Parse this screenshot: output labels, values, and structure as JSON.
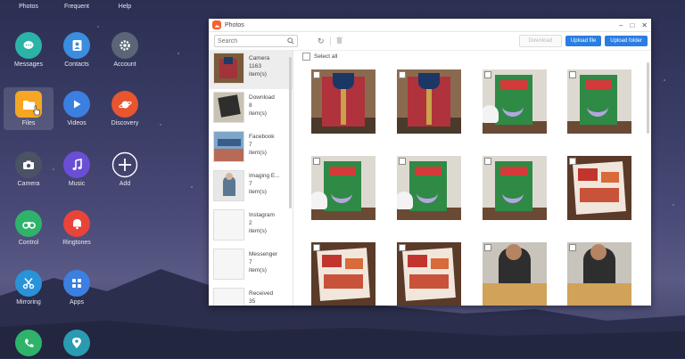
{
  "desktop": {
    "top_labels": [
      "Photos",
      "Frequent",
      "Help"
    ],
    "apps": [
      {
        "label": "Messages",
        "icon": "chat-icon",
        "color": "#2bb3a7"
      },
      {
        "label": "Contacts",
        "icon": "contacts-icon",
        "color": "#3b8de0"
      },
      {
        "label": "Account",
        "icon": "gear-icon",
        "color": "#5b6575"
      },
      {
        "label": "Files",
        "icon": "folder-icon",
        "color": "#f5a623"
      },
      {
        "label": "Videos",
        "icon": "play-icon",
        "color": "#3b7fe0"
      },
      {
        "label": "Discovery",
        "icon": "planet-icon",
        "color": "#e8552f"
      },
      {
        "label": "Camera",
        "icon": "camera-icon",
        "color": "#4a5364"
      },
      {
        "label": "Music",
        "icon": "music-icon",
        "color": "#6a4fd6"
      },
      {
        "label": "Add",
        "icon": "plus-icon",
        "color": "transparent"
      },
      {
        "label": "Control",
        "icon": "binoculars-icon",
        "color": "#2fb36b"
      },
      {
        "label": "Ringtones",
        "icon": "bell-icon",
        "color": "#e8443a"
      },
      {
        "label": "Mirroring",
        "icon": "scissors-icon",
        "color": "#2a92d8"
      },
      {
        "label": "Apps",
        "icon": "grid-icon",
        "color": "#3b7fe0"
      },
      {
        "label": "",
        "icon": "phone-icon",
        "color": "#2fb36b"
      },
      {
        "label": "",
        "icon": "location-icon",
        "color": "#2a9bb0"
      }
    ]
  },
  "window": {
    "title": "Photos",
    "controls": [
      "–",
      "□",
      "✕"
    ],
    "search_placeholder": "Search",
    "toolbar": {
      "download": "Download",
      "upload_file": "Upload file",
      "upload_folder": "Upload folder"
    },
    "albums": [
      {
        "name": "Camera",
        "count": "1163",
        "unit": "item(s)"
      },
      {
        "name": "Download",
        "count": "8",
        "unit": "item(s)"
      },
      {
        "name": "Facebook",
        "count": "7",
        "unit": "item(s)"
      },
      {
        "name": "Imaging E...",
        "count": "7",
        "unit": "item(s)"
      },
      {
        "name": "Instagram",
        "count": "2",
        "unit": "item(s)"
      },
      {
        "name": "Messenger",
        "count": "7",
        "unit": "item(s)"
      },
      {
        "name": "Received",
        "count": "35",
        "unit": "item(s)"
      }
    ],
    "select_all": "Select all",
    "photos": [
      {
        "type": "shirt"
      },
      {
        "type": "shirt"
      },
      {
        "type": "card-cat"
      },
      {
        "type": "card"
      },
      {
        "type": "card-cat"
      },
      {
        "type": "card-cat"
      },
      {
        "type": "card"
      },
      {
        "type": "menu"
      },
      {
        "type": "menu"
      },
      {
        "type": "menu"
      },
      {
        "type": "person"
      },
      {
        "type": "person"
      }
    ]
  },
  "colors": {
    "accent": "#2a7de1",
    "logo": "#f4622d"
  }
}
